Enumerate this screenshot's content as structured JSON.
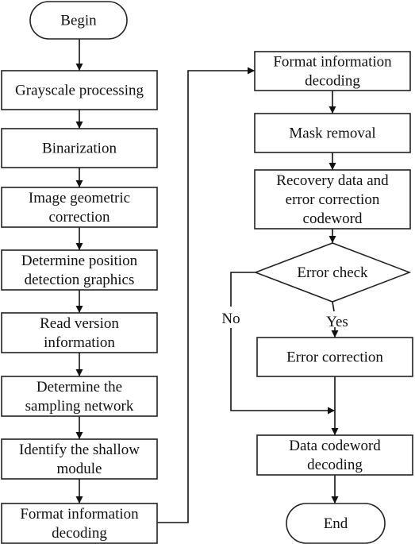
{
  "flowchart": {
    "nodes": {
      "begin": {
        "type": "terminator",
        "lines": [
          "Begin"
        ]
      },
      "grayscale": {
        "type": "process",
        "lines": [
          "Grayscale processing"
        ]
      },
      "binarization": {
        "type": "process",
        "lines": [
          "Binarization"
        ]
      },
      "geometric": {
        "type": "process",
        "lines": [
          "Image geometric",
          "correction"
        ]
      },
      "position": {
        "type": "process",
        "lines": [
          "Determine position",
          "detection graphics"
        ]
      },
      "version": {
        "type": "process",
        "lines": [
          "Read version",
          "information"
        ]
      },
      "sampling": {
        "type": "process",
        "lines": [
          "Determine the",
          "sampling network"
        ]
      },
      "shallow": {
        "type": "process",
        "lines": [
          "Identify the shallow",
          "module"
        ]
      },
      "format_left": {
        "type": "process",
        "lines": [
          "Format information",
          "decoding"
        ]
      },
      "format_right": {
        "type": "process",
        "lines": [
          "Format information",
          "decoding"
        ]
      },
      "mask": {
        "type": "process",
        "lines": [
          "Mask removal"
        ]
      },
      "recovery": {
        "type": "process",
        "lines": [
          "Recovery data and",
          "error correction",
          "codeword"
        ]
      },
      "check": {
        "type": "decision",
        "lines": [
          "Error check"
        ]
      },
      "correction": {
        "type": "process",
        "lines": [
          "Error correction"
        ]
      },
      "datadecode": {
        "type": "process",
        "lines": [
          "Data codeword",
          "decoding"
        ]
      },
      "end": {
        "type": "terminator",
        "lines": [
          "End"
        ]
      }
    },
    "edges": [
      {
        "from": "begin",
        "to": "grayscale",
        "label": ""
      },
      {
        "from": "grayscale",
        "to": "binarization",
        "label": ""
      },
      {
        "from": "binarization",
        "to": "geometric",
        "label": ""
      },
      {
        "from": "geometric",
        "to": "position",
        "label": ""
      },
      {
        "from": "position",
        "to": "version",
        "label": ""
      },
      {
        "from": "version",
        "to": "sampling",
        "label": ""
      },
      {
        "from": "sampling",
        "to": "shallow",
        "label": ""
      },
      {
        "from": "shallow",
        "to": "format_left",
        "label": ""
      },
      {
        "from": "format_left",
        "to": "format_right",
        "label": ""
      },
      {
        "from": "format_right",
        "to": "mask",
        "label": ""
      },
      {
        "from": "mask",
        "to": "recovery",
        "label": ""
      },
      {
        "from": "recovery",
        "to": "check",
        "label": ""
      },
      {
        "from": "check",
        "to": "correction",
        "label": "Yes"
      },
      {
        "from": "check",
        "to": "datadecode",
        "label": "No"
      },
      {
        "from": "correction",
        "to": "datadecode",
        "label": ""
      },
      {
        "from": "datadecode",
        "to": "end",
        "label": ""
      }
    ],
    "labels": {
      "yes": "Yes",
      "no": "No"
    }
  }
}
